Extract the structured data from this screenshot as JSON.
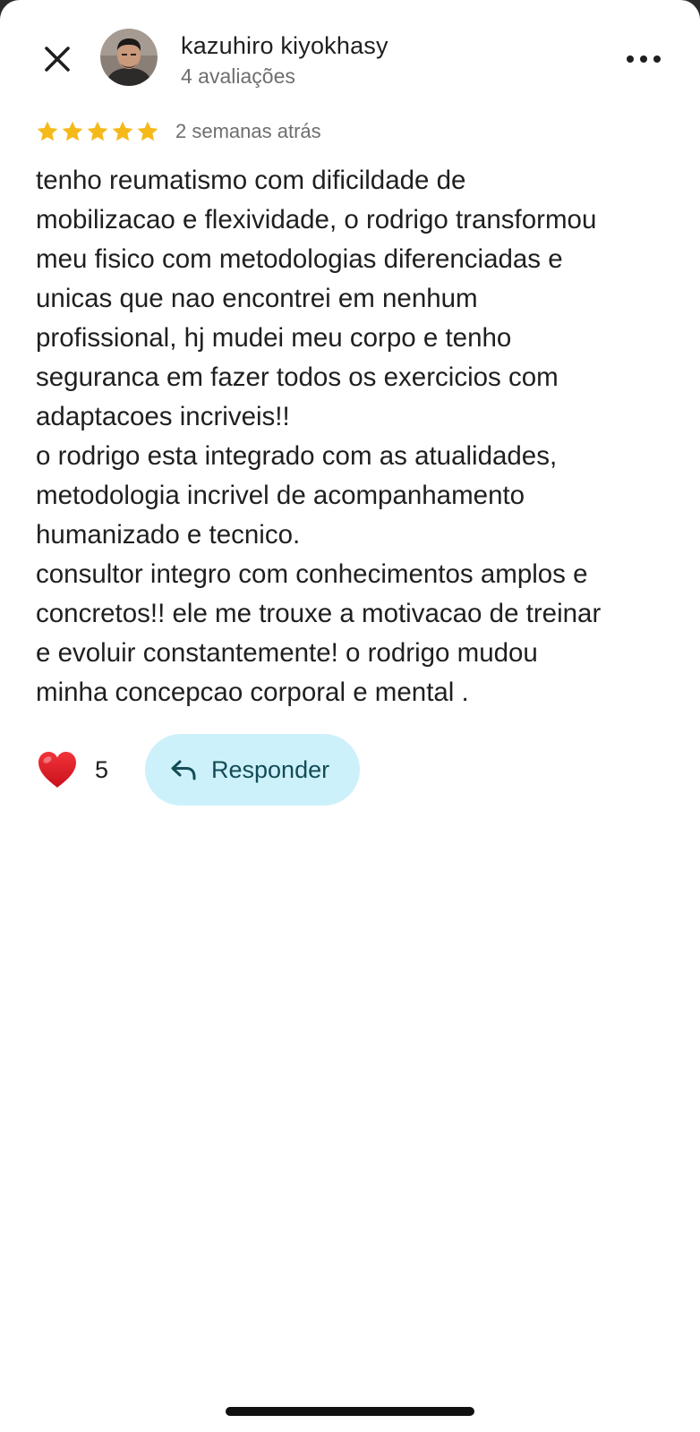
{
  "header": {
    "close_icon": "close-icon",
    "author_name": "kazuhiro kiyokhasy",
    "review_count": "4 avaliações",
    "more_icon": "more-horizontal-icon"
  },
  "review": {
    "rating": 5,
    "rating_max": 5,
    "star_color": "#f6b91a",
    "date": "2 semanas atrás",
    "text": "tenho reumatismo com dificildade de\nmobilizacao e flexividade, o rodrigo transformou\nmeu fisico com metodologias diferenciadas e\nunicas que nao encontrei em nenhum\nprofissional, hj mudei meu corpo e  tenho\nseguranca em fazer todos os exercicios com\nadaptacoes incriveis!!\no rodrigo esta  integrado com as atualidades,\nmetodologia incrivel de acompanhamento\nhumanizado e tecnico.\nconsultor integro com conhecimentos amplos e\nconcretos!! ele me trouxe a motivacao de treinar\ne evoluir constantemente! o rodrigo mudou\nminha concepcao corporal e mental ."
  },
  "actions": {
    "heart_icon": "heart-icon",
    "like_count": "5",
    "reply_icon": "reply-arrow-icon",
    "reply_label": "Responder",
    "reply_bg": "#cdf1fb"
  }
}
